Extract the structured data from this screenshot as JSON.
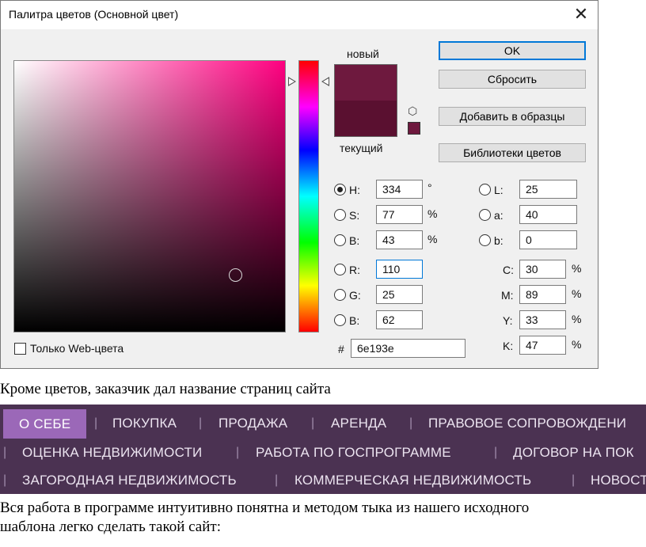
{
  "dialog": {
    "title": "Палитра цветов (Основной цвет)",
    "close_glyph": "✕",
    "label_new": "новый",
    "label_current": "текущий",
    "color_new": "#6e193e",
    "color_current": "#5a1030",
    "buttons": {
      "ok": "OK",
      "reset": "Сбросить",
      "add_swatch": "Добавить в образцы",
      "libraries": "Библиотеки цветов"
    },
    "hsb": {
      "h": {
        "label": "H:",
        "value": "334",
        "unit": "°"
      },
      "s": {
        "label": "S:",
        "value": "77",
        "unit": "%"
      },
      "b": {
        "label": "B:",
        "value": "43",
        "unit": "%"
      }
    },
    "rgb": {
      "r": {
        "label": "R:",
        "value": "110"
      },
      "g": {
        "label": "G:",
        "value": "25"
      },
      "b": {
        "label": "B:",
        "value": "62"
      }
    },
    "lab": {
      "l": {
        "label": "L:",
        "value": "25"
      },
      "a": {
        "label": "a:",
        "value": "40"
      },
      "b": {
        "label": "b:",
        "value": "0"
      }
    },
    "cmyk": {
      "c": {
        "label": "C:",
        "value": "30",
        "unit": "%"
      },
      "m": {
        "label": "M:",
        "value": "89",
        "unit": "%"
      },
      "y": {
        "label": "Y:",
        "value": "33",
        "unit": "%"
      },
      "k": {
        "label": "K:",
        "value": "47",
        "unit": "%"
      }
    },
    "hex": {
      "label": "#",
      "value": "6e193e"
    },
    "web_only_label": "Только Web-цвета",
    "cube_glyph": "⬡"
  },
  "doc": {
    "para1": "Кроме цветов, заказчик дал название страниц сайта",
    "para2_line1": "Вся работа в программе интуитивно понятна и методом тыка из нашего исходного",
    "para2_line2": "шаблона легко сделать такой сайт:"
  },
  "menu": {
    "separator": "|",
    "row1": [
      "О СЕБЕ",
      "ПОКУПКА",
      "ПРОДАЖА",
      "АРЕНДА",
      "ПРАВОВОЕ СОПРОВОЖДЕНИ"
    ],
    "row2": [
      "ОЦЕНКА НЕДВИЖИМОСТИ",
      "РАБОТА ПО ГОСПРОГРАММЕ",
      "ДОГОВОР НА ПОК"
    ],
    "row3": [
      "ЗАГОРОДНАЯ НЕДВИЖИМОСТЬ",
      "КОММЕРЧЕСКАЯ НЕДВИЖИМОСТЬ",
      "НОВОСТ"
    ]
  }
}
